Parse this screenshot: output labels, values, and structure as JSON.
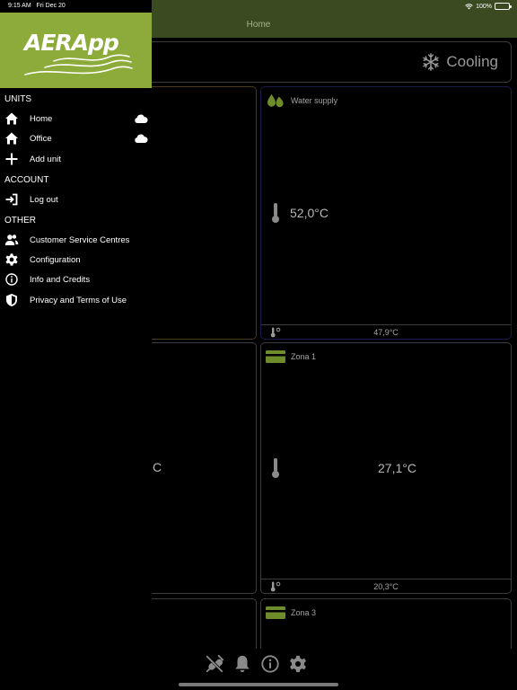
{
  "status_bar": {
    "time": "9:15 AM",
    "date": "Fri Dec 20",
    "battery": "100%",
    "battery_level": 1.0
  },
  "navbar": {
    "title": "Home"
  },
  "mode": {
    "label": "Cooling",
    "icon": "snowflake-icon"
  },
  "cards": {
    "water_supply": {
      "title": "Water supply",
      "temp": "52,0°C",
      "setpoint": "47,9°C",
      "icon": "water-drops-icon"
    },
    "zona1": {
      "title": "Zona 1",
      "temp": "27,1°C",
      "setpoint": "20,3°C",
      "icon": "thermostat-panel-icon"
    },
    "zona3": {
      "title": "Zona 3",
      "icon": "thermostat-panel-icon"
    },
    "left_partial": {
      "temp_fragment": "C"
    }
  },
  "drawer": {
    "logo": "AERApp",
    "sections": {
      "units": "UNITS",
      "account": "ACCOUNT",
      "other": "OTHER"
    },
    "units": [
      {
        "label": "Home",
        "icon": "home-icon",
        "cloud": true
      },
      {
        "label": "Office",
        "icon": "home-icon",
        "cloud": true
      },
      {
        "label": "Add unit",
        "icon": "plus-icon",
        "cloud": false
      }
    ],
    "account": [
      {
        "label": "Log out",
        "icon": "logout-icon"
      }
    ],
    "other": [
      {
        "label": "Customer Service Centres",
        "icon": "people-icon"
      },
      {
        "label": "Configuration",
        "icon": "gear-icon"
      },
      {
        "label": "Info and Credits",
        "icon": "info-icon"
      },
      {
        "label": "Privacy and Terms of Use",
        "icon": "shield-icon"
      }
    ]
  },
  "toolbar": {
    "icons": [
      "plug-disconnected-icon",
      "bell-icon",
      "info-icon",
      "gear-icon"
    ]
  },
  "colors": {
    "brand_green": "#8dab3a",
    "nav_bg": "#3a4a21",
    "accent_green": "#6f8c2a"
  }
}
